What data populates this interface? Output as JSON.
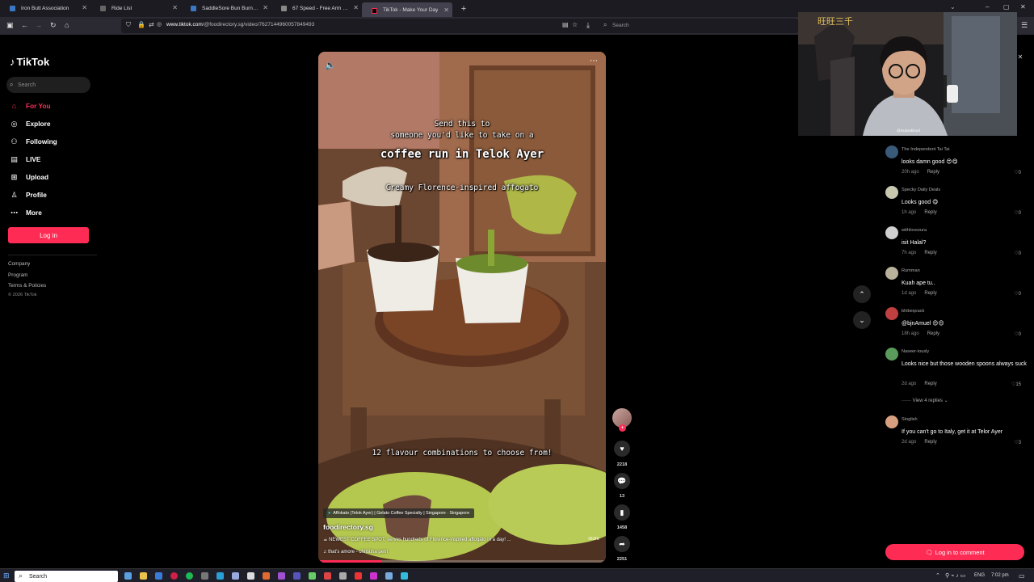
{
  "browser": {
    "tabs": [
      {
        "title": "Iron Butt Association",
        "active": false
      },
      {
        "title": "Ride List",
        "active": false
      },
      {
        "title": "SaddleSore Bun Burner Km Ser",
        "active": false
      },
      {
        "title": "67 Speed - Free Arm Speed Ch",
        "active": false
      },
      {
        "title": "TikTok - Make Your Day",
        "active": true
      }
    ],
    "url_host": "www.tiktok.com",
    "url_path": "/@foodirectory.sg/video/7627144960057849493",
    "search_placeholder": "Search"
  },
  "sidebar": {
    "logo_text": "TikTok",
    "search_placeholder": "Search",
    "nav": [
      {
        "label": "For You",
        "icon": "home-icon",
        "active": true
      },
      {
        "label": "Explore",
        "icon": "compass-icon",
        "active": false
      },
      {
        "label": "Following",
        "icon": "following-icon",
        "active": false
      },
      {
        "label": "LIVE",
        "icon": "live-icon",
        "active": false
      },
      {
        "label": "Upload",
        "icon": "upload-icon",
        "active": false
      },
      {
        "label": "Profile",
        "icon": "profile-icon",
        "active": false
      },
      {
        "label": "More",
        "icon": "more-icon",
        "active": false
      }
    ],
    "login_label": "Log in",
    "footer_links": [
      "Company",
      "Program",
      "Terms & Policies"
    ],
    "copyright": "© 2026 TikTok"
  },
  "video": {
    "overlay_texts": [
      "Send this to",
      "someone you'd like to take on a",
      "coffee run in Telok Ayer",
      "Creamy Florence-inspired affogato",
      "12 flavour combinations to choose from!"
    ],
    "location_chip": "Affokato (Telok Ayer) | Gelato Coffee Specialty | Singapore · Singapore",
    "author": "foodirectory.sg",
    "description": "NEWEST COFFEE SPOT, serves hundreds of Florence-inspired affogato in a day! ...",
    "more_label": "more",
    "music": "that's amore - christina perri",
    "progress": 0.22
  },
  "actions": {
    "likes": "2218",
    "comments": "13",
    "saves": "1458",
    "shares": "2251"
  },
  "webcam": {
    "overlay_sign": "旺旺三千",
    "shirt_text": "@mukasblood"
  },
  "comments": [
    {
      "user": "The Independent Tai Tai",
      "text": "looks damn good 😍😋",
      "time": "20h ago",
      "reply": "Reply",
      "likes": "0",
      "avatar_color": "#3a5a7a"
    },
    {
      "user": "Specky Daily Deals",
      "text": "Looks good 😋",
      "time": "1h ago",
      "reply": "Reply",
      "likes": "0",
      "avatar_color": "#c9c9b0"
    },
    {
      "user": "withlovezura",
      "text": "isit Halal?",
      "time": "7h ago",
      "reply": "Reply",
      "likes": "0",
      "avatar_color": "#cfcfcf"
    },
    {
      "user": "Rumman",
      "text": "Kuah ape tu..",
      "time": "1d ago",
      "reply": "Reply",
      "likes": "0",
      "avatar_color": "#b9b19a"
    },
    {
      "user": "bhibeqvack",
      "text": "@bjnAmuel 😍😍",
      "time": "18h ago",
      "reply": "Reply",
      "likes": "0",
      "avatar_color": "#c04040"
    },
    {
      "user": "Naseer-iously",
      "text": "Looks nice but those wooden spoons always suck",
      "time": "2d ago",
      "reply": "Reply",
      "likes": "15",
      "avatar_color": "#5a9a5a"
    },
    {
      "user": "Singlish",
      "text": "If you can't go to Italy, get it at Telor Ayer",
      "time": "2d ago",
      "reply": "Reply",
      "likes": "3",
      "avatar_color": "#d6a080"
    }
  ],
  "view_replies": "View 4 replies",
  "comment_login": "Log in to comment",
  "taskbar": {
    "search": "Search",
    "lang": "ENG",
    "time": "7:02 pm"
  },
  "colors": {
    "accent": "#fe2c55",
    "background": "#000000",
    "browser_chrome": "#2b2a33"
  }
}
